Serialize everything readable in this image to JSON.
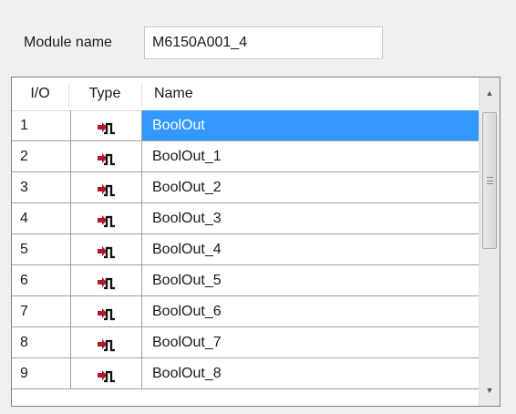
{
  "module": {
    "label": "Module name",
    "value": "M6150A001_4"
  },
  "table": {
    "headers": {
      "io": "I/O",
      "type": "Type",
      "name": "Name"
    },
    "type_icon": "digital-output-pulse-icon",
    "selected_index": 0,
    "selection_color": "#3399ff",
    "rows": [
      {
        "io": "1",
        "name": "BoolOut"
      },
      {
        "io": "2",
        "name": "BoolOut_1"
      },
      {
        "io": "3",
        "name": "BoolOut_2"
      },
      {
        "io": "4",
        "name": "BoolOut_3"
      },
      {
        "io": "5",
        "name": "BoolOut_4"
      },
      {
        "io": "6",
        "name": "BoolOut_5"
      },
      {
        "io": "7",
        "name": "BoolOut_6"
      },
      {
        "io": "8",
        "name": "BoolOut_7"
      },
      {
        "io": "9",
        "name": "BoolOut_8"
      }
    ]
  },
  "scrollbar": {
    "up_icon": "scroll-up-arrow-icon",
    "down_icon": "scroll-down-arrow-icon"
  }
}
